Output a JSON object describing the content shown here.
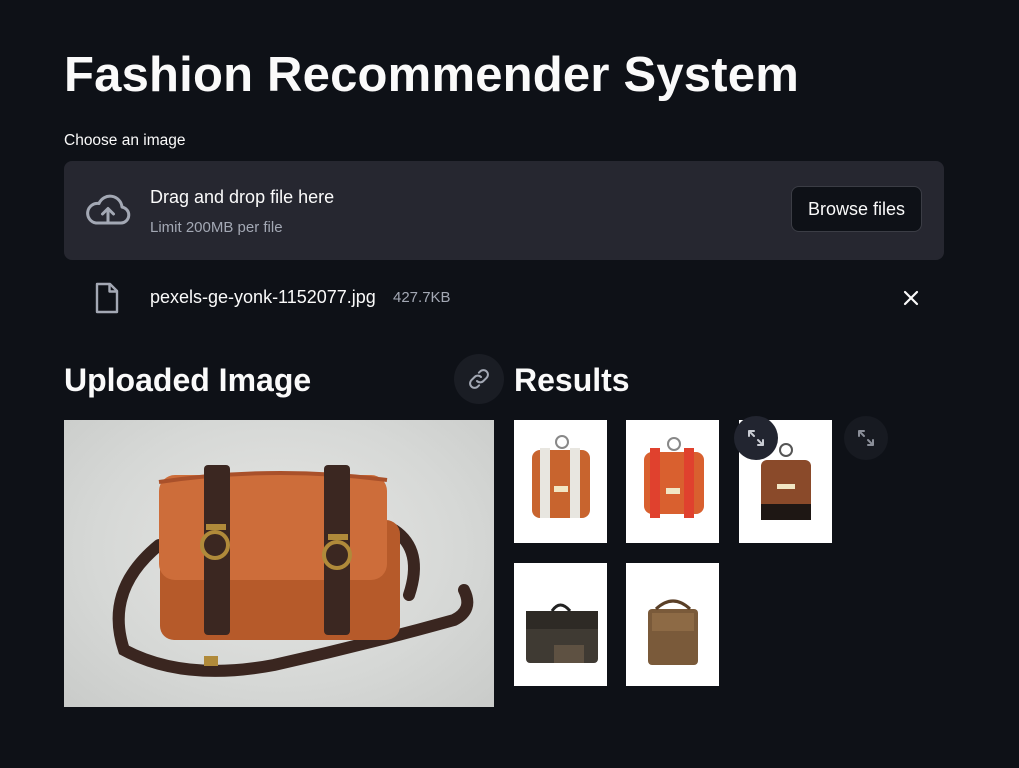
{
  "page": {
    "title": "Fashion Recommender System"
  },
  "uploader": {
    "label": "Choose an image",
    "drag_text": "Drag and drop file here",
    "limit_text": "Limit 200MB per file",
    "browse_label": "Browse files",
    "file": {
      "name": "pexels-ge-yonk-1152077.jpg",
      "size": "427.7KB"
    }
  },
  "uploaded_section": {
    "heading": "Uploaded Image"
  },
  "results_section": {
    "heading": "Results",
    "items": [
      {
        "name": "orange-satchel-white-strap",
        "color": "#c8642e"
      },
      {
        "name": "orange-satchel-red-strap",
        "color": "#d9532f"
      },
      {
        "name": "brown-backpack-black-strap",
        "color": "#8a4a2a"
      },
      {
        "name": "dark-grey-briefcase",
        "color": "#3f3a33"
      },
      {
        "name": "brown-crossbody-bag",
        "color": "#7a5a3a"
      }
    ]
  },
  "icons": {
    "upload": "cloud-upload-icon",
    "file": "file-icon",
    "close": "close-icon",
    "link": "link-icon",
    "expand": "fullscreen-icon"
  },
  "colors": {
    "background": "#0e1117",
    "dropzone": "#262730",
    "text": "#fafafa",
    "muted_text": "#a3a8b4"
  }
}
